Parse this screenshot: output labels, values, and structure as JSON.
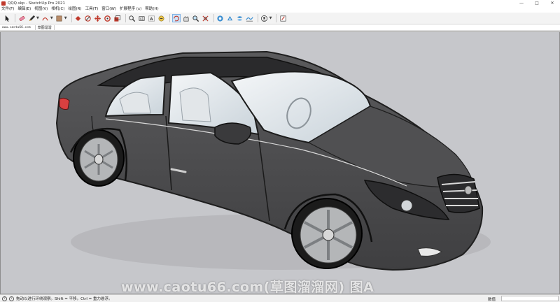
{
  "window": {
    "title": "QQQ.skp - SketchUp Pro 2021",
    "minimize": "—",
    "maximize": "□",
    "close": "✕"
  },
  "menu": {
    "items": [
      "文件(F)",
      "编辑(E)",
      "视图(V)",
      "相机(C)",
      "绘图(R)",
      "工具(T)",
      "窗口(W)",
      "扩展程序 (x)",
      "帮助(H)"
    ]
  },
  "toolbar": {
    "icons": [
      "select-icon",
      "eraser-icon",
      "pencil-icon",
      "arc-icon",
      "shape-icon",
      "push-pull-icon",
      "offset-icon",
      "move-icon",
      "rotate-icon",
      "scale-icon",
      "follow-me-icon",
      "tape-icon",
      "text-icon",
      "dimension-icon",
      "paint-icon",
      "orbit-icon",
      "pan-icon",
      "zoom-icon",
      "zoom-extents-icon",
      "warehouse-icon",
      "extension-warehouse-icon",
      "layout-icon",
      "sandbox-icon",
      "account-icon",
      "edit-icon"
    ]
  },
  "scenes": {
    "watermark": "www.caotu66.com",
    "active_tab": "草图溜溜"
  },
  "viewport": {
    "background": "#c6c7cb",
    "car_color": "#4a4a4c",
    "watermark": "www.caotu66.com(草图溜溜网) 图A"
  },
  "status": {
    "hint": "拖动以进行环绕观察。Shift = 平移。Ctrl = 重力悬浮。",
    "measure_label": "数值",
    "measure_value": ""
  }
}
